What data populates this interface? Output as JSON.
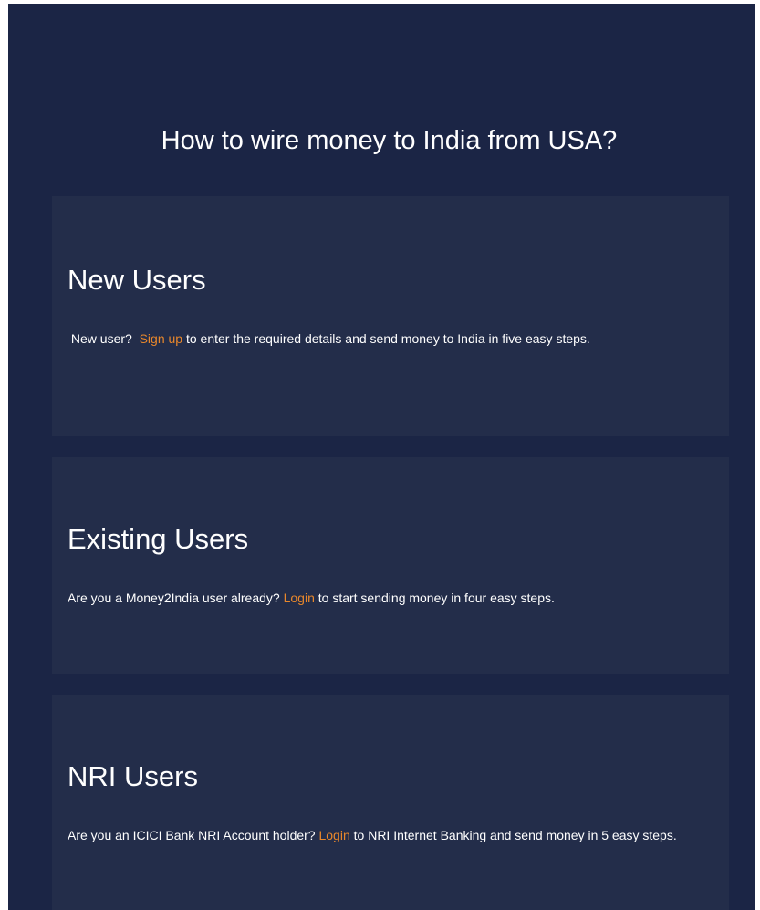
{
  "page": {
    "title": "How to wire money to India from USA?"
  },
  "sections": {
    "new_users": {
      "heading": "New Users",
      "text_before": "New user?",
      "link": "Sign up",
      "text_after": "to enter the required details and send money to India in five easy steps."
    },
    "existing_users": {
      "heading": "Existing Users",
      "text_before": "Are you a Money2India user already?",
      "link": "Login",
      "text_after": "to start sending money in four easy steps."
    },
    "nri_users": {
      "heading": "NRI Users",
      "text_before": "Are you an ICICI Bank NRI Account holder?",
      "link": "Login",
      "text_after": "to NRI Internet Banking and send money in 5 easy steps."
    }
  },
  "colors": {
    "background": "#1b2545",
    "card": "#232d4a",
    "link": "#e8872b",
    "text": "#ffffff"
  }
}
